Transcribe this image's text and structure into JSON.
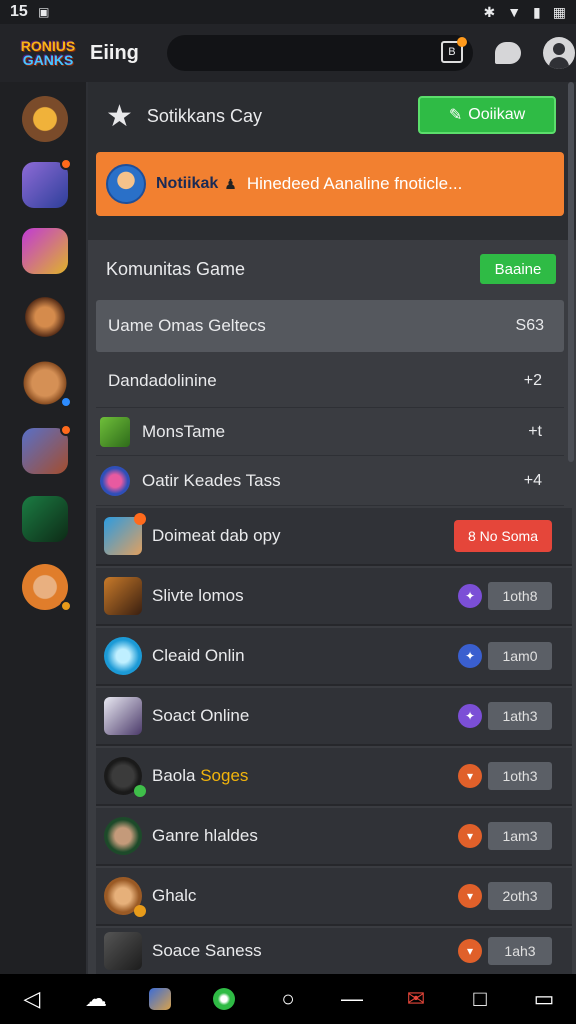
{
  "status_bar": {
    "time": "15",
    "left_icon": "image-icon",
    "right_icons": [
      "bluetooth-icon",
      "wifi-icon",
      "battery-icon",
      "calendar-icon"
    ]
  },
  "top_bar": {
    "logo_line1": "RONIUS",
    "logo_line2": "GANKS",
    "app_title": "Eiing",
    "search_placeholder": "",
    "search_icon_glyph": "B"
  },
  "sidebar": {
    "servers": [
      {
        "name": "server-1",
        "color": "#7a4b2a",
        "badge": false
      },
      {
        "name": "server-2",
        "color": "#5c6fd6",
        "badge": true
      },
      {
        "name": "server-3",
        "color": "#9b3dc8",
        "badge": false
      },
      {
        "name": "server-4",
        "color": "#a2582c",
        "badge": false
      },
      {
        "name": "server-5",
        "color": "#c07a3a",
        "badge": true
      },
      {
        "name": "server-6",
        "color": "#3b5aa0",
        "badge": true
      },
      {
        "name": "server-7",
        "color": "#1f6b3a",
        "badge": false
      },
      {
        "name": "server-8",
        "color": "#e07d2b",
        "badge": true
      }
    ]
  },
  "header": {
    "title": "Sotikkans Cay",
    "button_label": "Ooiikaw"
  },
  "banner": {
    "label": "Notiikak",
    "text": "Hinedeed Aanaline fnoticle..."
  },
  "community": {
    "title": "Komunitas Game",
    "button_label": "Baaine",
    "selected_row": {
      "label": "Uame Omas Geltecs",
      "value": "S63"
    },
    "rows": [
      {
        "label": "Dandadolinine",
        "value": "+2"
      },
      {
        "label": "MonsTame",
        "value": "+t"
      },
      {
        "label": "Oatir Keades Tass",
        "value": "+4"
      }
    ]
  },
  "games": [
    {
      "label": "Doimeat dab opy",
      "action": "8 No Soma",
      "type": "red"
    },
    {
      "label": "Slivte lomos",
      "pill": "1oth8",
      "dot_color": "#7b4fd6"
    },
    {
      "label": "Cleaid Onlin",
      "pill": "1am0",
      "dot_color": "#3a5fcf"
    },
    {
      "label": "Soact Online",
      "pill": "1ath3",
      "dot_color": "#7b4fd6"
    },
    {
      "label_main": "Baola",
      "label_highlight": "Soges",
      "pill": "1oth3",
      "dot_color": "#e0602a"
    },
    {
      "label": "Ganre hlaldes",
      "pill": "1am3",
      "dot_color": "#e0602a"
    },
    {
      "label": "Ghalc",
      "pill": "2oth3",
      "dot_color": "#e0602a"
    },
    {
      "label": "Soace Saness",
      "pill": "1ah3",
      "dot_color": "#e0602a"
    }
  ],
  "nav_bar": {
    "items": [
      "back-icon",
      "cloud-icon",
      "app-icon",
      "game-icon",
      "home-icon",
      "minus-icon",
      "mail-icon",
      "square-icon",
      "window-icon"
    ]
  }
}
